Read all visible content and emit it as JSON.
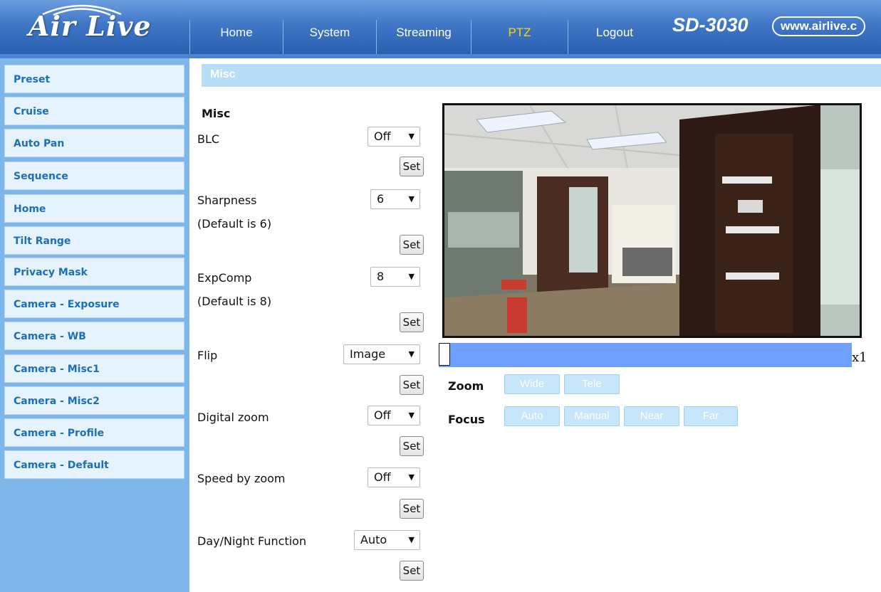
{
  "header": {
    "logo_text": "Air Live",
    "nav": [
      "Home",
      "System",
      "Streaming",
      "PTZ",
      "Logout"
    ],
    "active_nav": "PTZ",
    "model": "SD-3030",
    "site": "www.airlive.c"
  },
  "sidebar": {
    "items": [
      "Preset",
      "Cruise",
      "Auto Pan",
      "Sequence",
      "Home",
      "Tilt Range",
      "Privacy Mask",
      "Camera - Exposure",
      "Camera - WB",
      "Camera - Misc1",
      "Camera - Misc2",
      "Camera - Profile",
      "Camera - Default"
    ]
  },
  "main": {
    "section_title": "Misc",
    "heading": "Misc",
    "set_label": "Set",
    "settings": {
      "blc": {
        "label": "BLC",
        "value": "Off"
      },
      "sharpness": {
        "label": "Sharpness",
        "note": "(Default is 6)",
        "value": "6"
      },
      "expcomp": {
        "label": "ExpComp",
        "note": "(Default is 8)",
        "value": "8"
      },
      "flip": {
        "label": "Flip",
        "value": "Image"
      },
      "digital_zoom": {
        "label": "Digital zoom",
        "value": "Off"
      },
      "speed_by_zoom": {
        "label": "Speed by zoom",
        "value": "Off"
      },
      "day_night": {
        "label": "Day/Night Function",
        "value": "Auto"
      }
    }
  },
  "ptz": {
    "zoom_level": "x1",
    "zoom_level_fraction": 0.0,
    "zoom_label": "Zoom",
    "zoom_buttons": [
      "Wide",
      "Tele"
    ],
    "focus_label": "Focus",
    "focus_buttons": [
      "Auto",
      "Manual",
      "Near",
      "Far"
    ]
  },
  "colors": {
    "header_blue": "#3f77c6",
    "sidebar_blue": "#7fb6ea",
    "active_nav": "#ffd400",
    "zoom_track": "#6fa0ff"
  }
}
